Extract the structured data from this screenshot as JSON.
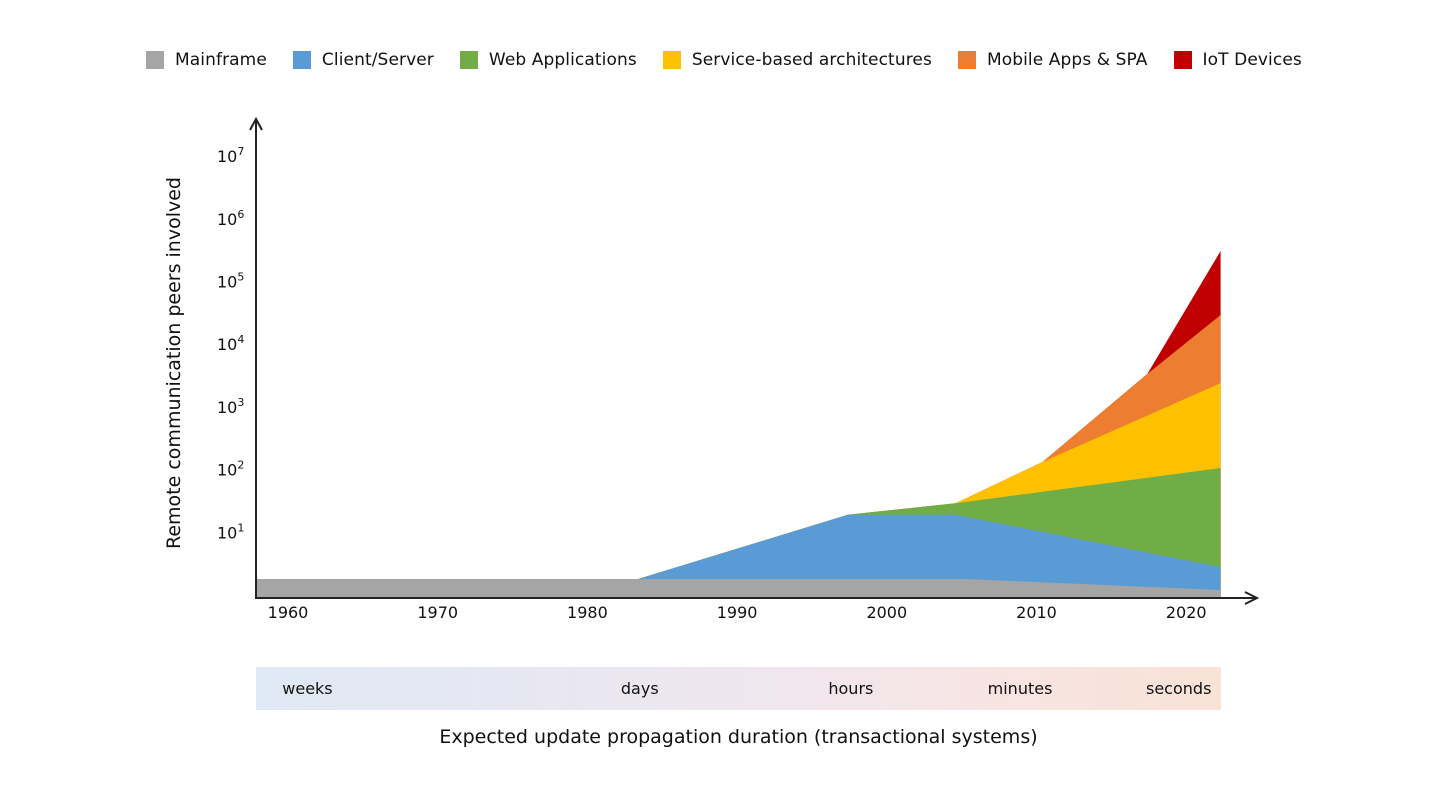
{
  "chart_data": {
    "type": "area",
    "stacked": true,
    "yscale": "log",
    "title": "",
    "xlabel": "Expected update propagation duration (transactional systems)",
    "ylabel": "Remote communication peers involved",
    "xlim": [
      1957.9,
      2022.3
    ],
    "ylim_log10": [
      0,
      7.6
    ],
    "x_ticks": [
      1960,
      1970,
      1980,
      1990,
      2000,
      2010,
      2020
    ],
    "x_tick_labels": [
      "1960",
      "1970",
      "1980",
      "1990",
      "2000",
      "2010",
      "2020"
    ],
    "y_ticks": [
      {
        "base": "10",
        "exp": "1",
        "value": 10
      },
      {
        "base": "10",
        "exp": "2",
        "value": 100
      },
      {
        "base": "10",
        "exp": "3",
        "value": 1000
      },
      {
        "base": "10",
        "exp": "4",
        "value": 10000
      },
      {
        "base": "10",
        "exp": "5",
        "value": 100000
      },
      {
        "base": "10",
        "exp": "6",
        "value": 1000000
      },
      {
        "base": "10",
        "exp": "7",
        "value": 10000000
      }
    ],
    "legend_position": "top",
    "series": [
      {
        "name": "Mainframe",
        "color": "#a5a5a5",
        "cumulative_top": [
          [
            1957.9,
            1.8
          ],
          [
            2005.3,
            1.8
          ],
          [
            2022.3,
            1.2
          ]
        ]
      },
      {
        "name": "Client/Server",
        "color": "#5b9bd5",
        "cumulative_top": [
          [
            1957.9,
            1.8
          ],
          [
            1983.4,
            1.8
          ],
          [
            1997.4,
            19
          ],
          [
            2004.6,
            19
          ],
          [
            2022.3,
            2.8
          ]
        ]
      },
      {
        "name": "Web Applications",
        "color": "#70ad47",
        "cumulative_top": [
          [
            1957.9,
            1.8
          ],
          [
            1983.4,
            1.8
          ],
          [
            1997.4,
            19
          ],
          [
            2004.6,
            29
          ],
          [
            2022.3,
            106
          ]
        ]
      },
      {
        "name": "Service-based architectures",
        "color": "#ffc000",
        "cumulative_top": [
          [
            1957.9,
            1.8
          ],
          [
            1983.4,
            1.8
          ],
          [
            1997.4,
            19
          ],
          [
            2004.6,
            29
          ],
          [
            2010.4,
            132
          ],
          [
            2022.3,
            2400
          ]
        ]
      },
      {
        "name": "Mobile Apps & SPA",
        "color": "#ed7d31",
        "cumulative_top": [
          [
            1957.9,
            1.8
          ],
          [
            1983.4,
            1.8
          ],
          [
            1997.4,
            19
          ],
          [
            2004.6,
            29
          ],
          [
            2010.4,
            132
          ],
          [
            2017.4,
            3350
          ],
          [
            2022.3,
            29200
          ]
        ]
      },
      {
        "name": "IoT Devices",
        "color": "#c00000",
        "cumulative_top": [
          [
            1957.9,
            1.8
          ],
          [
            1983.4,
            1.8
          ],
          [
            1997.4,
            19
          ],
          [
            2004.6,
            29
          ],
          [
            2010.4,
            132
          ],
          [
            2017.4,
            3350
          ],
          [
            2022.3,
            306000
          ]
        ]
      }
    ],
    "duration_scale": {
      "labels": [
        "weeks",
        "days",
        "hours",
        "minutes",
        "seconds"
      ],
      "at_years": [
        1961.3,
        1983.5,
        1997.6,
        2008.9,
        2019.5
      ]
    }
  }
}
